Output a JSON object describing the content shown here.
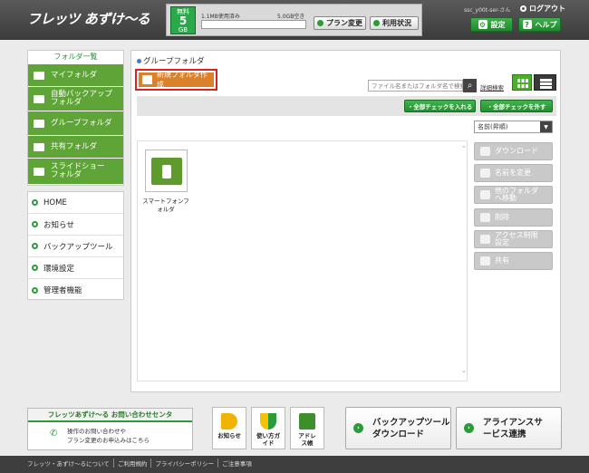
{
  "header": {
    "logo_main": "フレッツ あずけ〜る",
    "plan": {
      "line1": "無料",
      "size": "5",
      "unit": "GB"
    },
    "usage_used": "1.1MB使用済み",
    "usage_free": "5.0GB空き",
    "plan_change_label": "プラン変更",
    "usage_status_label": "利用状況",
    "username": "ssc_y00t-ser-さん",
    "logout_label": "ログアウト",
    "settings_label": "設定",
    "help_label": "ヘルプ"
  },
  "sidebar": {
    "title": "フォルダ一覧",
    "folders": [
      {
        "label": "マイフォルダ"
      },
      {
        "label": "自動バックアップフォルダ"
      },
      {
        "label": "グループフォルダ"
      },
      {
        "label": "共有フォルダ"
      },
      {
        "label": "スライドショーフォルダ"
      }
    ],
    "nav": [
      {
        "label": "HOME"
      },
      {
        "label": "お知らせ"
      },
      {
        "label": "バックアップツール"
      },
      {
        "label": "環境設定"
      },
      {
        "label": "管理者機能"
      }
    ]
  },
  "main": {
    "breadcrumb": "グループフォルダ",
    "new_folder_label": "新規フォルダ作成",
    "search_placeholder": "ファイル名またはフォルダ名で検索",
    "advanced_search": "詳細検索",
    "check_all": "・全部チェックを入れる",
    "uncheck_all": "・全部チェックを外す",
    "sort_value": "名前(昇順)",
    "items": [
      {
        "label": "スマートフォンフォルダ"
      }
    ],
    "actions": [
      {
        "label": "ダウンロード"
      },
      {
        "label": "名前を変更"
      },
      {
        "label": "他のフォルダへ移動"
      },
      {
        "label": "削除"
      },
      {
        "label": "アクセス制限設定"
      },
      {
        "label": "共有"
      }
    ]
  },
  "bottom": {
    "contact_title": "フレッツあずけ〜る お問い合わせセンタ",
    "contact_line1": "操作のお問い合わせや",
    "contact_line2": "プラン変更のお申込みはこちら",
    "tiles": [
      {
        "label": "お知らせ"
      },
      {
        "label": "使い方ガイド"
      },
      {
        "label": "アドレス帳"
      }
    ],
    "backup_tool": "バックアップツールダウンロード",
    "alliance": "アライアンスサービス連携"
  },
  "footer": {
    "links": [
      "フレッツ・あずけ〜るについて",
      "ご利用規約",
      "プライバシーポリシー",
      "ご注意事項"
    ]
  },
  "colors": {
    "green": "#5ea436",
    "orange": "#d9822b",
    "header": "#3b3b3b"
  }
}
